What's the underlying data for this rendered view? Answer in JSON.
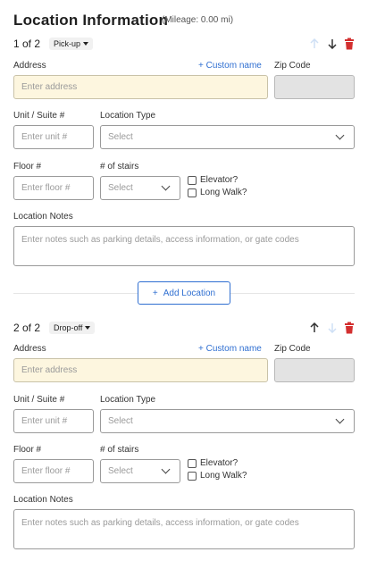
{
  "header": {
    "title": "Location Information",
    "mileage": "(Mileage: 0.00 mi)"
  },
  "labels": {
    "address": "Address",
    "custom_name": "+ Custom name",
    "zip": "Zip Code",
    "unit": "Unit / Suite #",
    "location_type": "Location Type",
    "floor": "Floor #",
    "stairs": "# of stairs",
    "elevator": "Elevator?",
    "long_walk": "Long Walk?",
    "notes": "Location Notes"
  },
  "placeholders": {
    "address": "Enter address",
    "unit": "Enter unit #",
    "select": "Select",
    "floor": "Enter floor #",
    "notes": "Enter notes such as parking details, access information, or gate codes"
  },
  "locations": [
    {
      "sequence": "1 of 2",
      "type": "Pick-up",
      "move_up_enabled": false,
      "move_down_enabled": true
    },
    {
      "sequence": "2 of 2",
      "type": "Drop-off",
      "move_up_enabled": true,
      "move_down_enabled": false
    }
  ],
  "actions": {
    "add_location": "Add Location"
  },
  "colors": {
    "link": "#2f6fd1",
    "delete": "#d32f2f",
    "address_bg": "#fdf6df",
    "zip_bg": "#e3e3e3",
    "disabled_arrow": "#cfe0f5"
  },
  "icons": {
    "move_up": "arrow-up-icon",
    "move_down": "arrow-down-icon",
    "delete": "trash-icon",
    "dropdown": "chevron-down-icon"
  }
}
